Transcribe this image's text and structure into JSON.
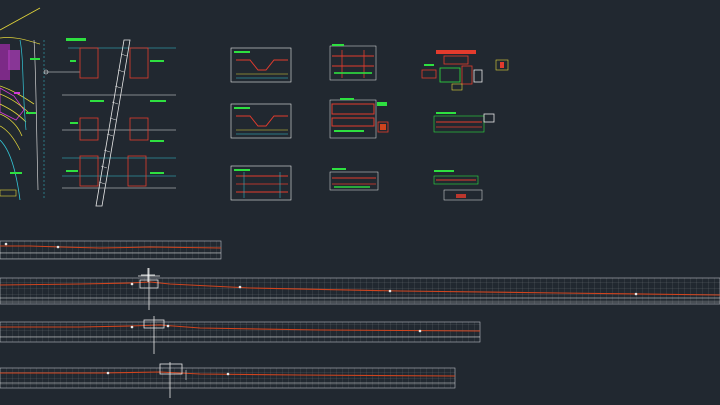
{
  "viewport": {
    "app": "CAD model space",
    "background_color": "#212830"
  },
  "drawing": {
    "sheets": [
      {
        "id": "cross-section-1",
        "kind": "road cross section"
      },
      {
        "id": "cross-section-2",
        "kind": "road cross section"
      },
      {
        "id": "cross-section-3",
        "kind": "road cross section"
      },
      {
        "id": "detail-1",
        "kind": "construction detail"
      },
      {
        "id": "detail-2",
        "kind": "construction detail"
      },
      {
        "id": "detail-3",
        "kind": "construction detail"
      },
      {
        "id": "detail-4",
        "kind": "construction detail"
      },
      {
        "id": "detail-5",
        "kind": "construction detail"
      },
      {
        "id": "detail-6",
        "kind": "construction detail"
      }
    ],
    "profile_strips": [
      {
        "id": "profile-1",
        "kind": "longitudinal profile"
      },
      {
        "id": "profile-2",
        "kind": "longitudinal profile"
      },
      {
        "id": "profile-3",
        "kind": "longitudinal profile"
      },
      {
        "id": "profile-4",
        "kind": "longitudinal profile"
      }
    ],
    "colors": {
      "grid": "#8a8f96",
      "profile_line": "#d0441e",
      "construction_red": "#e33b2d",
      "green_text": "#2ee040",
      "cyan_lines": "#34c6d6",
      "magenta": "#d43bd8",
      "yellow": "#e3d63a",
      "white": "#e8e8e8"
    },
    "icons": [
      "crosshair-cursor-icon"
    ]
  }
}
